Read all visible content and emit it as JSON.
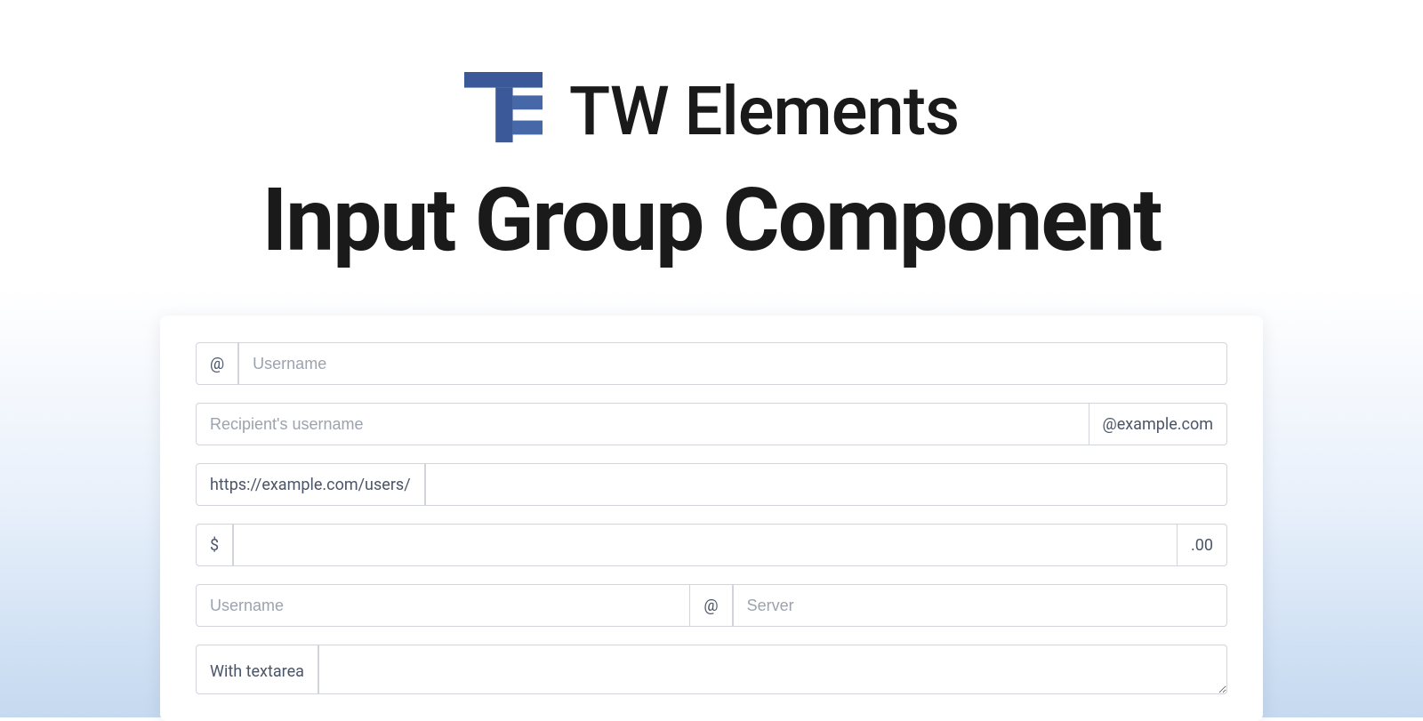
{
  "header": {
    "brand_name": "TW Elements",
    "page_title": "Input Group Component"
  },
  "groups": {
    "username_prefix": {
      "addon": "@",
      "placeholder": "Username"
    },
    "recipient_suffix": {
      "placeholder": "Recipient's username",
      "addon": "@example.com"
    },
    "url_prefix": {
      "addon": "https://example.com/users/"
    },
    "currency": {
      "prefix": "$",
      "suffix": ".00"
    },
    "user_server": {
      "placeholder_user": "Username",
      "addon": "@",
      "placeholder_server": "Server"
    },
    "textarea": {
      "addon": "With textarea"
    }
  },
  "colors": {
    "brand": "#3b5998",
    "border": "#d1d5db",
    "text": "#4a5568",
    "placeholder": "#9ca3af"
  }
}
